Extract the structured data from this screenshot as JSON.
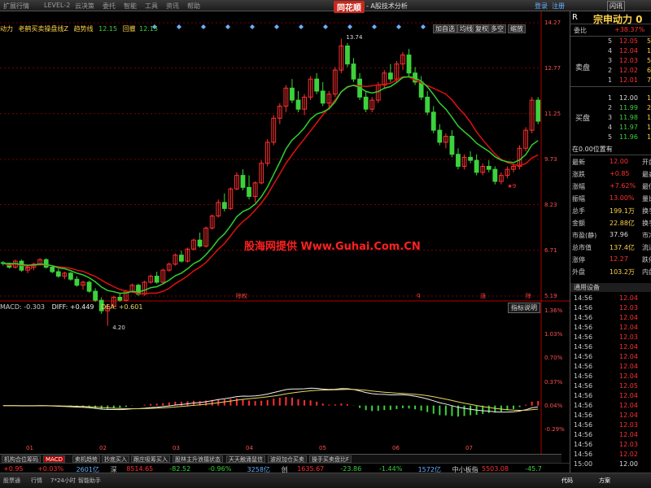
{
  "menu": {
    "items": [
      "扩展行情",
      "LEVEL-2",
      "云决策",
      "委托",
      "智能",
      "工具",
      "资讯",
      "帮助"
    ],
    "app_title": "同花顺",
    "subtitle": "- A股技术分析",
    "login": "登录",
    "register": "注册",
    "window_btn": "闪讯"
  },
  "chart_header": {
    "stock": "动力",
    "indicator": "老鹤买卖操盘线Z",
    "trend_label": "趋势线",
    "trend_value": "12.15",
    "retreat_label": "回撤",
    "retreat_value": "12.15"
  },
  "toolbar": [
    "加自选",
    "均线",
    "复权",
    "多空",
    "缩放"
  ],
  "watermark": "股海网提供 Www.Guhai.Com.CN",
  "macd_header": {
    "title": "MACD: -0.303",
    "diff": "DIFF: +0.449",
    "dea": "DEA: +0.601"
  },
  "macd_explain": "指标说明",
  "events": [
    {
      "label": "除权",
      "color": "#ff4040"
    },
    {
      "label": "q",
      "color": "#ff4040"
    },
    {
      "label": "涨",
      "color": "#ff4040"
    },
    {
      "label": "除",
      "color": "#ff4040"
    }
  ],
  "colors": {
    "up": "#ff3030",
    "down": "#3cd23c",
    "ma": "#e01010",
    "trend": "#30d030",
    "grid": "#7a0000",
    "axis": "#b00000",
    "diff": "#f0f0f0",
    "dea": "#e8d860"
  },
  "chart_data": [
    {
      "type": "candlestick",
      "title": "老鹤买卖操盘线Z",
      "y_ticks": [
        "14.27",
        "12.77",
        "11.25",
        "9.73",
        "8.23",
        "6.71",
        "5.19"
      ],
      "ylim": [
        5.19,
        14.27
      ],
      "price_annotations": [
        "13.74",
        "4.20"
      ],
      "x_ticks": [
        "01",
        "02",
        "03",
        "04",
        "05",
        "06",
        "07"
      ],
      "markers": [
        "★1",
        "★9"
      ],
      "candles": [
        [
          6.3,
          6.35,
          6.2,
          6.28
        ],
        [
          6.28,
          6.3,
          6.1,
          6.15
        ],
        [
          6.15,
          6.4,
          6.1,
          6.35
        ],
        [
          6.35,
          6.4,
          6.0,
          6.05
        ],
        [
          6.05,
          6.2,
          5.95,
          6.15
        ],
        [
          6.15,
          6.3,
          6.05,
          6.25
        ],
        [
          6.25,
          6.45,
          6.2,
          6.4
        ],
        [
          6.4,
          6.45,
          6.1,
          6.15
        ],
        [
          6.15,
          6.2,
          5.95,
          6.0
        ],
        [
          6.0,
          6.1,
          5.8,
          5.85
        ],
        [
          5.85,
          6.0,
          5.75,
          5.95
        ],
        [
          5.95,
          6.0,
          5.7,
          5.75
        ],
        [
          5.75,
          5.85,
          5.5,
          5.55
        ],
        [
          5.55,
          5.7,
          5.4,
          5.65
        ],
        [
          5.65,
          5.7,
          5.3,
          5.35
        ],
        [
          5.35,
          5.45,
          5.0,
          5.05
        ],
        [
          5.05,
          5.15,
          4.6,
          4.7
        ],
        [
          4.7,
          4.9,
          4.2,
          4.85
        ],
        [
          4.85,
          5.2,
          4.8,
          5.15
        ],
        [
          5.15,
          5.3,
          5.0,
          5.05
        ],
        [
          5.05,
          5.4,
          5.0,
          5.35
        ],
        [
          5.35,
          5.6,
          5.3,
          5.55
        ],
        [
          5.55,
          5.6,
          5.2,
          5.25
        ],
        [
          5.25,
          5.7,
          5.2,
          5.65
        ],
        [
          5.65,
          5.9,
          5.6,
          5.85
        ],
        [
          5.85,
          6.0,
          5.6,
          5.65
        ],
        [
          5.65,
          6.1,
          5.6,
          6.05
        ],
        [
          6.05,
          6.3,
          6.0,
          6.25
        ],
        [
          6.25,
          6.6,
          6.2,
          6.55
        ],
        [
          6.55,
          6.7,
          6.3,
          6.35
        ],
        [
          6.35,
          6.8,
          6.3,
          6.75
        ],
        [
          6.75,
          7.1,
          6.7,
          7.05
        ],
        [
          7.05,
          7.3,
          6.8,
          6.85
        ],
        [
          6.85,
          7.5,
          6.8,
          7.45
        ],
        [
          7.45,
          7.9,
          7.4,
          7.85
        ],
        [
          7.85,
          8.4,
          7.8,
          8.3
        ],
        [
          8.3,
          8.6,
          8.0,
          8.1
        ],
        [
          8.1,
          8.8,
          8.05,
          8.75
        ],
        [
          8.75,
          9.3,
          8.7,
          9.2
        ],
        [
          9.2,
          9.4,
          8.7,
          8.8
        ],
        [
          8.8,
          9.2,
          8.4,
          8.5
        ],
        [
          8.5,
          9.0,
          8.3,
          8.95
        ],
        [
          8.95,
          9.7,
          8.9,
          9.6
        ],
        [
          9.6,
          10.4,
          9.5,
          10.3
        ],
        [
          10.3,
          11.2,
          10.2,
          11.1
        ],
        [
          11.1,
          11.6,
          10.9,
          11.5
        ],
        [
          11.5,
          12.2,
          11.3,
          12.1
        ],
        [
          12.1,
          12.4,
          11.6,
          11.7
        ],
        [
          11.7,
          12.0,
          11.3,
          11.4
        ],
        [
          11.4,
          11.9,
          11.2,
          11.8
        ],
        [
          11.8,
          12.5,
          11.7,
          12.4
        ],
        [
          12.4,
          12.6,
          11.9,
          12.0
        ],
        [
          12.0,
          12.3,
          11.5,
          11.6
        ],
        [
          11.6,
          12.0,
          11.4,
          11.9
        ],
        [
          11.9,
          12.8,
          11.8,
          12.7
        ],
        [
          12.7,
          13.74,
          12.6,
          13.5
        ],
        [
          13.5,
          13.6,
          12.8,
          12.9
        ],
        [
          12.9,
          13.1,
          12.3,
          12.4
        ],
        [
          12.4,
          12.6,
          11.7,
          11.8
        ],
        [
          11.8,
          12.0,
          11.3,
          11.4
        ],
        [
          11.4,
          11.8,
          11.3,
          11.7
        ],
        [
          11.7,
          12.3,
          11.6,
          12.2
        ],
        [
          12.2,
          12.7,
          12.1,
          12.6
        ],
        [
          12.6,
          12.9,
          12.3,
          12.4
        ],
        [
          12.4,
          13.0,
          12.3,
          12.9
        ],
        [
          12.9,
          13.3,
          12.7,
          13.2
        ],
        [
          13.2,
          13.4,
          12.5,
          12.6
        ],
        [
          12.6,
          12.8,
          12.2,
          12.3
        ],
        [
          12.3,
          12.5,
          11.7,
          11.8
        ],
        [
          11.8,
          12.0,
          11.2,
          11.3
        ],
        [
          11.3,
          11.5,
          10.6,
          10.7
        ],
        [
          10.7,
          10.9,
          10.2,
          10.3
        ],
        [
          10.3,
          10.6,
          10.1,
          10.5
        ],
        [
          10.5,
          10.7,
          9.8,
          9.9
        ],
        [
          9.9,
          10.1,
          9.4,
          9.5
        ],
        [
          9.5,
          9.9,
          9.4,
          9.8
        ],
        [
          9.8,
          10.0,
          9.6,
          9.7
        ],
        [
          9.7,
          9.9,
          9.2,
          9.3
        ],
        [
          9.3,
          9.6,
          9.2,
          9.5
        ],
        [
          9.5,
          9.7,
          9.3,
          9.4
        ],
        [
          9.4,
          9.5,
          8.9,
          9.0
        ],
        [
          9.0,
          9.3,
          8.9,
          9.2
        ],
        [
          9.2,
          9.5,
          9.1,
          9.4
        ],
        [
          9.4,
          9.6,
          9.3,
          9.5
        ],
        [
          9.5,
          10.2,
          9.4,
          10.1
        ],
        [
          10.1,
          10.8,
          10.0,
          10.7
        ],
        [
          10.7,
          11.8,
          10.6,
          11.7
        ],
        [
          11.7,
          11.8,
          10.9,
          11.0
        ]
      ]
    },
    {
      "type": "line",
      "title": "MACD",
      "y_ticks": [
        "1.36%",
        "1.03%",
        "0.70%",
        "0.37%",
        "0.04%",
        "-0.29%"
      ]
    }
  ],
  "right_panel": {
    "r_label": "R",
    "name": "宗申动力 0",
    "weibi_label": "委比",
    "weibi_value": "+38.37%",
    "sell_label": "卖盘",
    "buy_label": "买盘",
    "sells": [
      {
        "n": "5",
        "p": "12.05",
        "v": "5"
      },
      {
        "n": "4",
        "p": "12.04",
        "v": "1"
      },
      {
        "n": "3",
        "p": "12.03",
        "v": "5"
      },
      {
        "n": "2",
        "p": "12.02",
        "v": "6"
      },
      {
        "n": "1",
        "p": "12.01",
        "v": "7"
      }
    ],
    "buys": [
      {
        "n": "1",
        "p": "12.00",
        "v": "1"
      },
      {
        "n": "2",
        "p": "11.99",
        "v": "2"
      },
      {
        "n": "3",
        "p": "11.98",
        "v": "1"
      },
      {
        "n": "4",
        "p": "11.97",
        "v": "1"
      },
      {
        "n": "5",
        "p": "11.96",
        "v": "1"
      }
    ],
    "position_label": "在0.00位置有",
    "stats": [
      {
        "l": "最新",
        "v": "12.00",
        "e": "开盘",
        "c": "#ff3030"
      },
      {
        "l": "涨跌",
        "v": "+0.85",
        "e": "最高",
        "c": "#ff3030"
      },
      {
        "l": "涨幅",
        "v": "+7.62%",
        "e": "最低",
        "c": "#ff3030"
      },
      {
        "l": "振幅",
        "v": "13.00%",
        "e": "量比",
        "c": "#ff3030"
      },
      {
        "l": "总手",
        "v": "199.1万",
        "e": "换手",
        "c": "#ffd24a"
      },
      {
        "l": "金额",
        "v": "22.88亿",
        "e": "换手",
        "c": "#ffd24a"
      },
      {
        "l": "市盈(静)",
        "v": "37.96",
        "e": "市净",
        "c": "#dddddd"
      },
      {
        "l": "总市值",
        "v": "137.4亿",
        "e": "流通",
        "c": "#ffd24a"
      },
      {
        "l": "涨停",
        "v": "12.27",
        "e": "跌停",
        "c": "#ff3030"
      },
      {
        "l": "外盘",
        "v": "103.2万",
        "e": "内盘",
        "c": "#ffd24a"
      }
    ],
    "device_label": "通用设备",
    "ticks": [
      {
        "t": "14:56",
        "p": "12.04"
      },
      {
        "t": "14:56",
        "p": "12.03"
      },
      {
        "t": "14:56",
        "p": "12.04"
      },
      {
        "t": "14:56",
        "p": "12.04"
      },
      {
        "t": "14:56",
        "p": "12.03"
      },
      {
        "t": "14:56",
        "p": "12.04"
      },
      {
        "t": "14:56",
        "p": "12.04"
      },
      {
        "t": "14:56",
        "p": "12.04"
      },
      {
        "t": "14:56",
        "p": "12.04"
      },
      {
        "t": "14:56",
        "p": "12.05"
      },
      {
        "t": "14:56",
        "p": "12.04"
      },
      {
        "t": "14:56",
        "p": "12.04"
      },
      {
        "t": "14:56",
        "p": "12.04"
      },
      {
        "t": "14:56",
        "p": "12.03"
      },
      {
        "t": "14:56",
        "p": "12.04"
      },
      {
        "t": "14:56",
        "p": "12.03"
      },
      {
        "t": "14:56",
        "p": "12.02"
      },
      {
        "t": "15:00",
        "p": "12.00"
      }
    ]
  },
  "tabs": [
    "机构合位筹码",
    "MACD",
    "卖机趋势",
    "抄底买入",
    "跟庄吸筹买入",
    "股林主升浪擂状态",
    "天天触涌鼠信",
    "波段加仓买卖",
    "操手买卖盘比F"
  ],
  "ticker": {
    "items": [
      {
        "t": "+0.95",
        "c": "#ff3030"
      },
      {
        "t": "+0.03%",
        "c": "#ff3030"
      },
      {
        "t": "2601亿",
        "c": "#6ab0ff"
      },
      {
        "t": "深",
        "c": "#ccc"
      },
      {
        "t": "8514.65",
        "c": "#ff3030"
      },
      {
        "t": "-82.52",
        "c": "#3cd23c"
      },
      {
        "t": "-0.96%",
        "c": "#3cd23c"
      },
      {
        "t": "3258亿",
        "c": "#6ab0ff"
      },
      {
        "t": "创",
        "c": "#ccc"
      },
      {
        "t": "1635.67",
        "c": "#ff3030"
      },
      {
        "t": "-23.86",
        "c": "#3cd23c"
      },
      {
        "t": "-1.44%",
        "c": "#3cd23c"
      },
      {
        "t": "1572亿",
        "c": "#6ab0ff"
      },
      {
        "t": "中小板指",
        "c": "#ccc"
      },
      {
        "t": "5503.08",
        "c": "#ff3030"
      },
      {
        "t": "-45.7",
        "c": "#3cd23c"
      }
    ]
  },
  "status": [
    "股票通",
    "行情",
    "7*24小时",
    "智能助手"
  ],
  "status_right": [
    "代码",
    "方案"
  ]
}
